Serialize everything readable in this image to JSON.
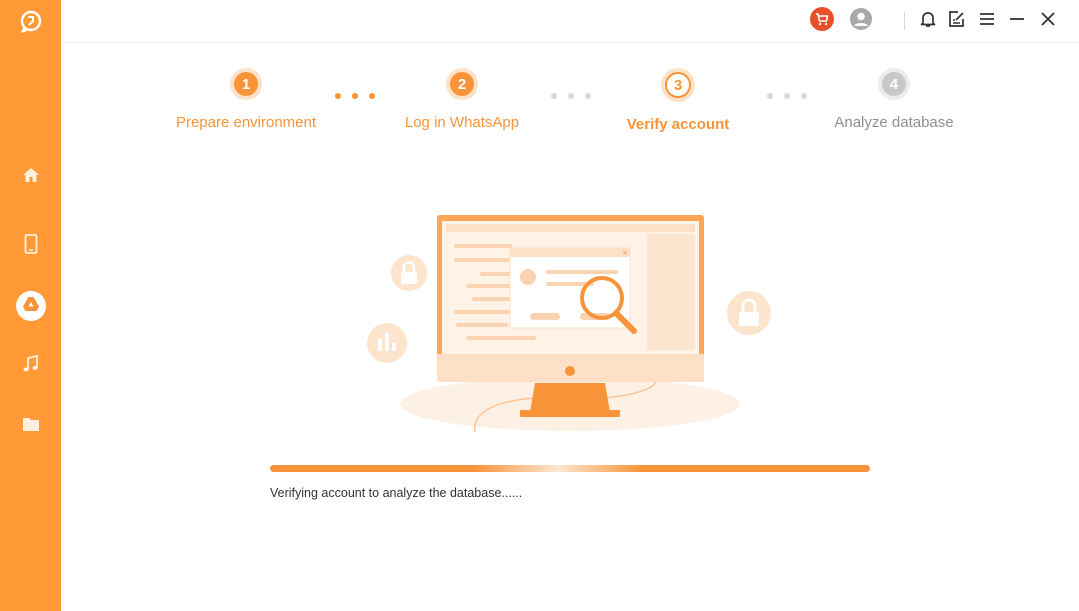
{
  "sidebar": {
    "items": [
      {
        "name": "home",
        "icon": "home-icon"
      },
      {
        "name": "device",
        "icon": "phone-icon"
      },
      {
        "name": "google-drive",
        "icon": "google-drive-icon",
        "active": true
      },
      {
        "name": "music",
        "icon": "music-note-icon"
      },
      {
        "name": "files",
        "icon": "folder-icon"
      }
    ]
  },
  "titlebar": {
    "buttons": [
      "cart-icon",
      "user-icon",
      "bell-icon",
      "feedback-icon",
      "menu-icon",
      "minimize-icon",
      "close-icon"
    ]
  },
  "steps": [
    {
      "number": "1",
      "label": "Prepare environment",
      "state": "done"
    },
    {
      "number": "2",
      "label": "Log in WhatsApp",
      "state": "done"
    },
    {
      "number": "3",
      "label": "Verify account",
      "state": "current"
    },
    {
      "number": "4",
      "label": "Analyze database",
      "state": "todo"
    }
  ],
  "progress": {
    "status_text": "Verifying account to analyze the database......"
  },
  "colors": {
    "accent": "#f7943a",
    "sidebar": "#ff9a36",
    "inactive": "#c8c8c8"
  }
}
